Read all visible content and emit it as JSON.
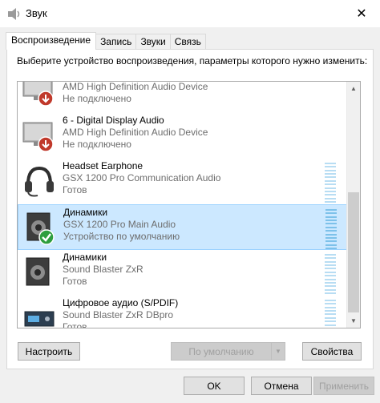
{
  "window": {
    "title": "Звук",
    "close_glyph": "✕"
  },
  "tabs": [
    {
      "label": "Воспроизведение",
      "active": true
    },
    {
      "label": "Запись"
    },
    {
      "label": "Звуки"
    },
    {
      "label": "Связь"
    }
  ],
  "instruction": "Выберите устройство воспроизведения, параметры которого нужно изменить:",
  "devices": [
    {
      "name": "",
      "desc": "AMD High Definition Audio Device",
      "status": "Не подключено",
      "icon": "monitor-disconnected-icon"
    },
    {
      "name": "6 - Digital Display Audio",
      "desc": "AMD High Definition Audio Device",
      "status": "Не подключено",
      "icon": "monitor-disconnected-icon"
    },
    {
      "name": "Headset Earphone",
      "desc": "GSX 1200 Pro Communication Audio",
      "status": "Готов",
      "icon": "headset-icon"
    },
    {
      "name": "Динамики",
      "desc": "GSX 1200 Pro Main Audio",
      "status": "Устройство по умолчанию",
      "icon": "speaker-default-icon",
      "selected": true
    },
    {
      "name": "Динамики",
      "desc": "Sound Blaster ZxR",
      "status": "Готов",
      "icon": "speaker-icon"
    },
    {
      "name": "Цифровое аудио (S/PDIF)",
      "desc": "Sound Blaster ZxR DBpro",
      "status": "Готов",
      "icon": "spdif-device-icon"
    }
  ],
  "buttons": {
    "configure": "Настроить",
    "set_default": "По умолчанию",
    "properties": "Свойства",
    "ok": "OK",
    "cancel": "Отмена",
    "apply": "Применить"
  },
  "colors": {
    "selection": "#cce8ff",
    "meter": "#b8ddf3",
    "disconnected_badge": "#c0392b",
    "default_badge": "#2e9e3e"
  }
}
